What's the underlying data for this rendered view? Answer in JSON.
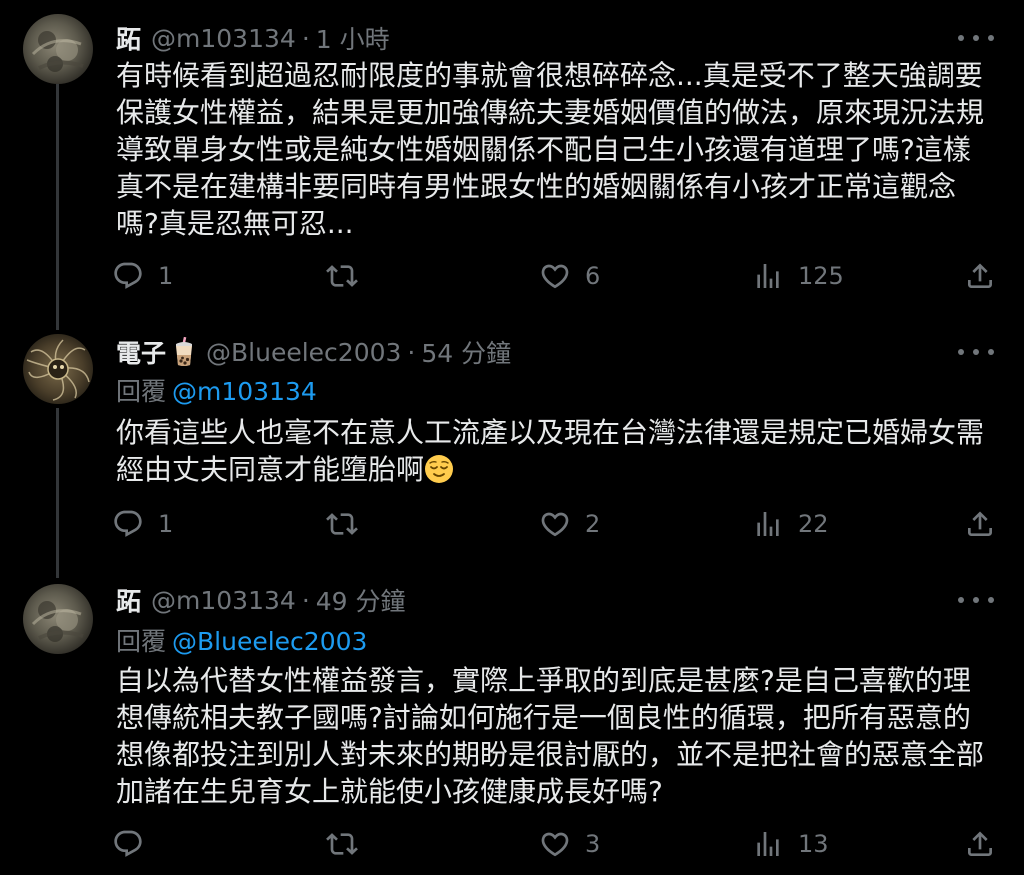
{
  "tweets": [
    {
      "name": "跖",
      "handle": "@m103134",
      "dot": "·",
      "time": "1 小時",
      "replying_prefix": "",
      "replying_to": "",
      "lines": [
        "有時候看到超過忍耐限度的事就會很想碎碎念...真是受不了整天強調要",
        "保護女性權益，結果是更加強傳統夫妻婚姻價值的做法，原來現況法規",
        "導致單身女性或是純女性婚姻關係不配自己生小孩還有道理了嗎?這樣",
        "真不是在建構非要同時有男性跟女性的婚姻關係有小孩才正常這觀念",
        "嗎?真是忍無可忍..."
      ],
      "replies": "1",
      "retweets": "",
      "likes": "6",
      "views": "125"
    },
    {
      "name": "電子",
      "handle": "@Blueelec2003",
      "dot": "·",
      "time": "54 分鐘",
      "replying_prefix": "回覆",
      "replying_to": "@m103134",
      "lines": [
        "你看這些人也毫不在意人工流產以及現在台灣法律還是規定已婚婦女需",
        "經由丈夫同意才能墮胎啊"
      ],
      "replies": "1",
      "retweets": "",
      "likes": "2",
      "views": "22"
    },
    {
      "name": "跖",
      "handle": "@m103134",
      "dot": "·",
      "time": "49 分鐘",
      "replying_prefix": "回覆",
      "replying_to": "@Blueelec2003",
      "lines": [
        "自以為代替女性權益發言，實際上爭取的到底是甚麼?是自己喜歡的理",
        "想傳統相夫教子國嗎?討論如何施行是一個良性的循環，把所有惡意的",
        "想像都投注到別人對未來的期盼是很討厭的，並不是把社會的惡意全部",
        "加諸在生兒育女上就能使小孩健康成長好嗎?"
      ],
      "replies": "",
      "retweets": "",
      "likes": "3",
      "views": "13"
    }
  ],
  "icons": {
    "reply": "reply-icon",
    "retweet": "retweet-icon",
    "like": "heart-icon",
    "views": "views-icon",
    "share": "share-icon",
    "more": "more-icon",
    "bubble_tea": "bubble-tea-icon",
    "relieved_face": "relieved-face-icon"
  },
  "colors": {
    "background": "#000000",
    "text": "#e7e9ea",
    "secondary": "#71767b",
    "link": "#1d9bf0",
    "thread_line": "#333639"
  }
}
